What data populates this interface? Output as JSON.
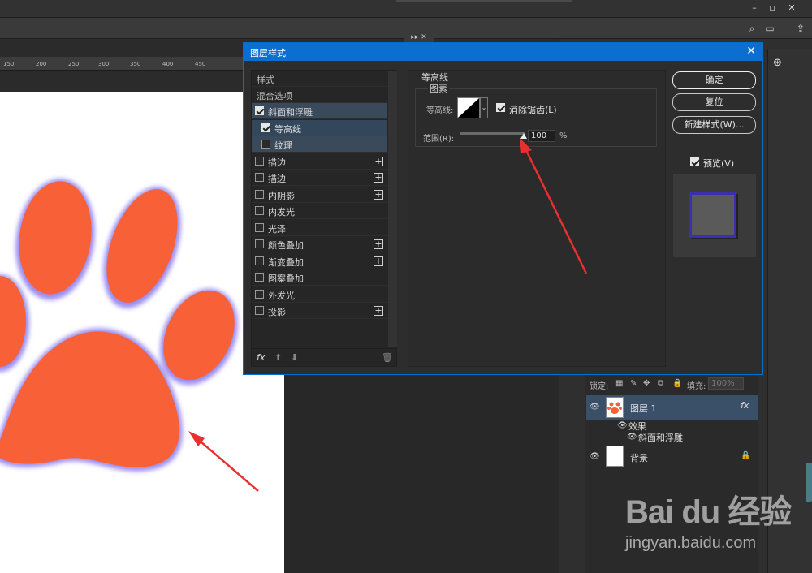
{
  "window": {
    "controls": [
      "–",
      "▫",
      "✕"
    ],
    "options_icons": [
      "search-icon",
      "frame-icon",
      "share-icon"
    ],
    "collapse_label": "▸▸ ✕"
  },
  "ruler": {
    "ticks": [
      "150",
      "200",
      "250",
      "300",
      "350",
      "400",
      "450"
    ]
  },
  "dialog": {
    "title": "图层样式",
    "close": "✕",
    "style_list": {
      "header_styles": "样式",
      "header_blend": "混合选项",
      "items": [
        {
          "label": "斜面和浮雕",
          "checked": true,
          "plus": false,
          "selected": "sel1",
          "indent": 0
        },
        {
          "label": "等高线",
          "checked": true,
          "plus": false,
          "selected": "sel2",
          "indent": 1
        },
        {
          "label": "纹理",
          "checked": false,
          "plus": false,
          "selected": "sel1",
          "indent": 1
        },
        {
          "label": "描边",
          "checked": false,
          "plus": true,
          "selected": "",
          "indent": 0
        },
        {
          "label": "描边",
          "checked": false,
          "plus": true,
          "selected": "",
          "indent": 0
        },
        {
          "label": "内阴影",
          "checked": false,
          "plus": true,
          "selected": "",
          "indent": 0
        },
        {
          "label": "内发光",
          "checked": false,
          "plus": false,
          "selected": "",
          "indent": 0
        },
        {
          "label": "光泽",
          "checked": false,
          "plus": false,
          "selected": "",
          "indent": 0
        },
        {
          "label": "颜色叠加",
          "checked": false,
          "plus": true,
          "selected": "",
          "indent": 0
        },
        {
          "label": "渐变叠加",
          "checked": false,
          "plus": true,
          "selected": "",
          "indent": 0
        },
        {
          "label": "图案叠加",
          "checked": false,
          "plus": false,
          "selected": "",
          "indent": 0
        },
        {
          "label": "外发光",
          "checked": false,
          "plus": false,
          "selected": "",
          "indent": 0
        },
        {
          "label": "投影",
          "checked": false,
          "plus": true,
          "selected": "",
          "indent": 0
        }
      ],
      "footer_fx": "fx",
      "footer_up": "⬆",
      "footer_down": "⬇",
      "footer_trash": "🗑"
    },
    "contour": {
      "group_title": "等高线",
      "element_title": "图素",
      "contour_label": "等高线:",
      "antialias_label": "消除锯齿(L)",
      "antialias_checked": true,
      "range_label": "范围(R):",
      "range_value": "100",
      "range_unit": "%",
      "range_fraction": 1.0
    },
    "buttons": {
      "ok": "确定",
      "reset": "复位",
      "new_style": "新建样式(W)...",
      "preview": "预览(V)",
      "preview_checked": true
    }
  },
  "layers": {
    "lock_label": "锁定:",
    "fill_label": "填充:",
    "fill_value": "100%",
    "items": [
      {
        "name": "图层 1",
        "fx": "fx",
        "effects_label": "效果",
        "effect": "斜面和浮雕"
      },
      {
        "name": "背景"
      }
    ]
  },
  "watermark": {
    "logo": "Bai du 经验",
    "url": "jingyan.baidu.com"
  },
  "colors": {
    "dialog_title_bar": "#0a6fd1",
    "paw_fill": "#f86138",
    "paw_glow": "#9a8cf0",
    "annotation_arrow": "#e8302f"
  }
}
